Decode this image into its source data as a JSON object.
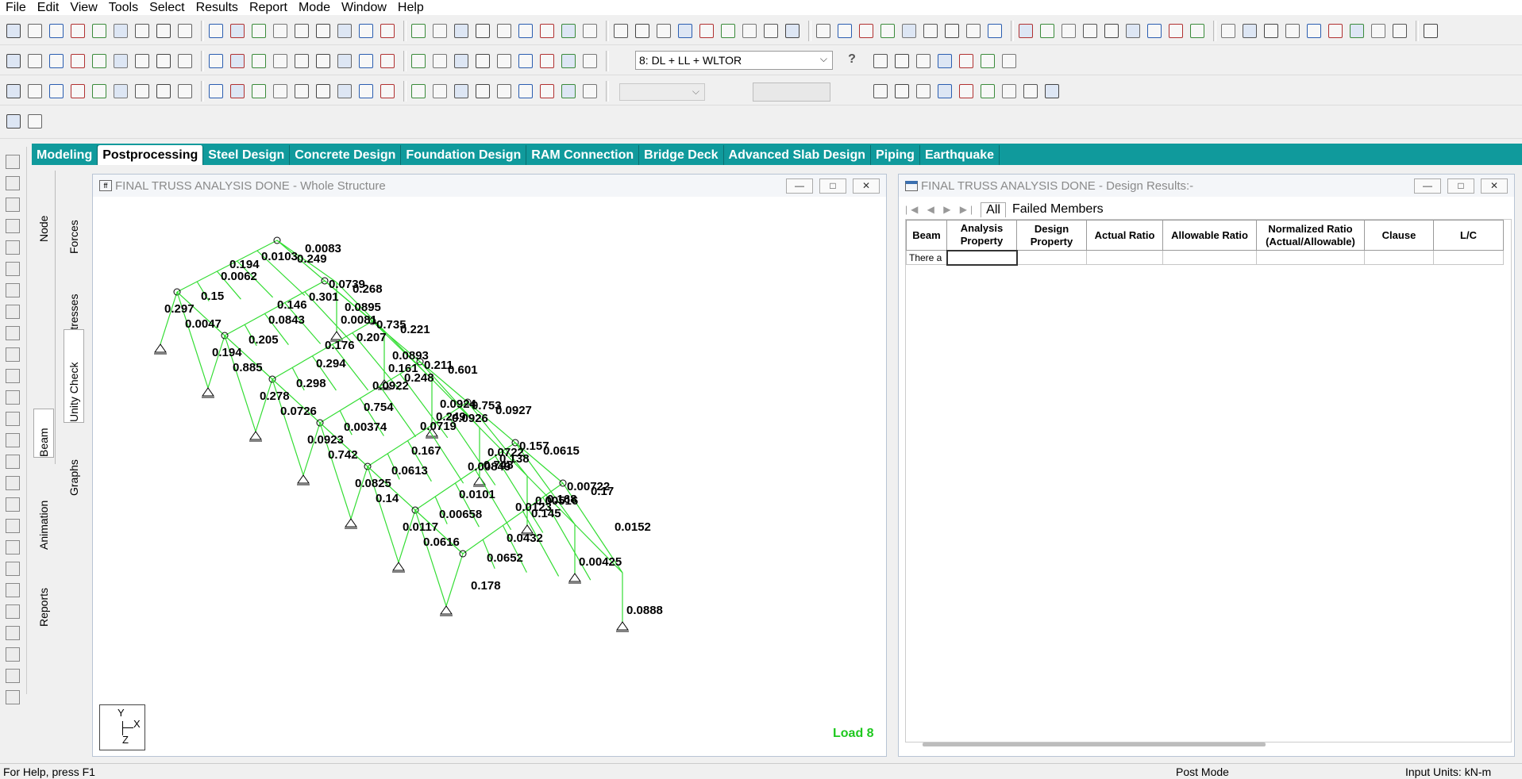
{
  "menu": [
    "File",
    "Edit",
    "View",
    "Tools",
    "Select",
    "Results",
    "Report",
    "Mode",
    "Window",
    "Help"
  ],
  "toolbar": {
    "load_case_select": "8: DL + LL + WLTOR",
    "help_button": "?"
  },
  "process_tabs": [
    "Modeling",
    "Postprocessing",
    "Steel Design",
    "Concrete Design",
    "Foundation Design",
    "RAM Connection",
    "Bridge Deck",
    "Advanced Slab Design",
    "Piping",
    "Earthquake"
  ],
  "active_process_tab": "Postprocessing",
  "side_tabs_outer": [
    "Node",
    "Beam",
    "Animation",
    "Reports"
  ],
  "side_tabs_inner": [
    "Forces",
    "Stresses",
    "Unity Check",
    "Graphs"
  ],
  "structure_window": {
    "title": "FINAL TRUSS ANALYSIS DONE - Whole Structure",
    "load_label": "Load 8",
    "axes": {
      "y": "Y",
      "x": "X",
      "z": "Z"
    },
    "unity_labels": [
      "0.0103",
      "0.0083",
      "0.0047",
      "0.0081",
      "0.0062",
      "0.0739",
      "0.15",
      "0.194",
      "0.249",
      "0.297",
      "0.301",
      "0.268",
      "0.885",
      "0.161",
      "0.0843",
      "0.735",
      "0.205",
      "0.146",
      "0.0895",
      "0.194",
      "0.207",
      "0.221",
      "0.0726",
      "0.249",
      "0.294",
      "0.211",
      "0.298",
      "0.176",
      "0.0893",
      "0.278",
      "0.248",
      "0.601",
      "0.742",
      "0.748",
      "0.754",
      "0.753",
      "0.00374",
      "0.0922",
      "0.0924",
      "0.0923",
      "0.0926",
      "0.0927",
      "0.14",
      "0.145",
      "0.167",
      "0.157",
      "0.0613",
      "0.0719",
      "0.0722",
      "0.0825",
      "0.138",
      "0.0615",
      "0.0616",
      "0.00425",
      "0.0101",
      "0.00722",
      "0.00658",
      "0.00849",
      "0.00516",
      "0.0117",
      "0.168",
      "0.17",
      "0.178",
      "0.0888",
      "0.0432",
      "0.0152",
      "0.0652",
      "0.0123"
    ]
  },
  "design_window": {
    "title": "FINAL TRUSS ANALYSIS DONE - Design Results:-",
    "tabs": [
      "All",
      "Failed Members"
    ],
    "columns": [
      "Beam",
      "Analysis Property",
      "Design Property",
      "Actual Ratio",
      "Allowable Ratio",
      "Normalized Ratio (Actual/Allowable)",
      "Clause",
      "L/C"
    ],
    "rows": [
      [
        "There a",
        "",
        "",
        "",
        "",
        "",
        "",
        ""
      ]
    ]
  },
  "status": {
    "help": "For Help, press F1",
    "mode": "Post Mode",
    "units": "Input Units:  kN-m"
  },
  "colors": {
    "tab_bar": "#109a9c",
    "member": "#33dd33",
    "load_label": "#1ec81e"
  }
}
